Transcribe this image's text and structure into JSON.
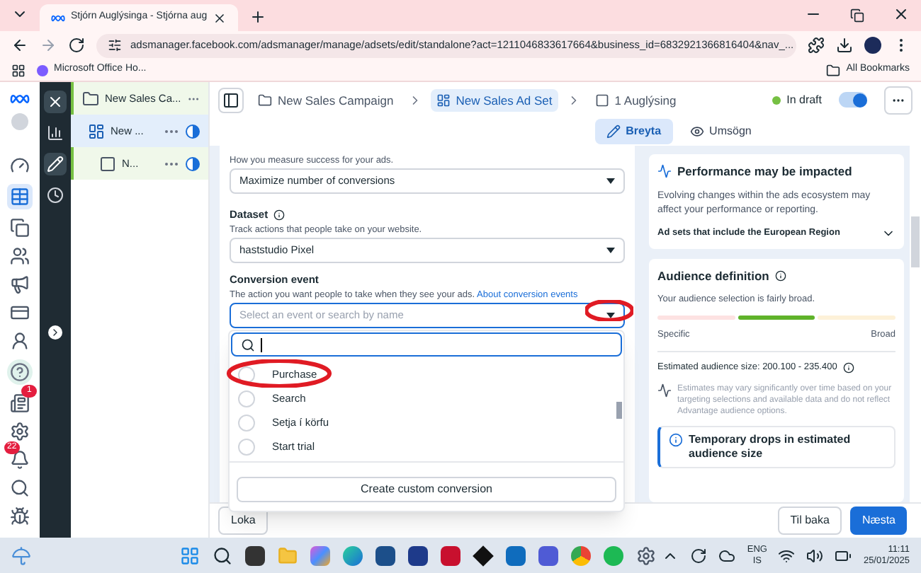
{
  "browser": {
    "tab_title": "Stjórn Auglýsinga - Stjórna aug",
    "url": "adsmanager.facebook.com/adsmanager/manage/adsets/edit/standalone?act=1211046833617664&business_id=683292136681640​4&nav_...",
    "bookmarks": [
      "Microsoft Office Ho..."
    ],
    "all_bookmarks": "All Bookmarks"
  },
  "rail_badges": {
    "notices": "1",
    "alerts": "22"
  },
  "tree": [
    {
      "label": "New Sales Ca...",
      "kind": "campaign",
      "selected": false
    },
    {
      "label": "New ...",
      "kind": "adset",
      "selected": true
    },
    {
      "label": "N...",
      "kind": "ad",
      "selected": false
    }
  ],
  "breadcrumbs": [
    {
      "label": "New Sales Campaign",
      "kind": "campaign",
      "selected": false
    },
    {
      "label": "New Sales Ad Set",
      "kind": "adset",
      "selected": true
    },
    {
      "label": "1 Auglýsing",
      "kind": "ad",
      "selected": false
    }
  ],
  "status": {
    "label": "In draft",
    "on": true
  },
  "mode_tabs": [
    {
      "label": "Breyta",
      "kind": "edit",
      "selected": true
    },
    {
      "label": "Umsögn",
      "kind": "review",
      "selected": false
    }
  ],
  "form": {
    "goal_hint": "How you measure success for your ads.",
    "goal_value": "Maximize number of conversions",
    "dataset": {
      "label": "Dataset",
      "hint": "Track actions that people take on your website.",
      "value": "haststudio Pixel"
    },
    "conversion_event": {
      "label": "Conversion event",
      "hint": "The action you want people to take when they see your ads.",
      "link": "About conversion events",
      "placeholder": "Select an event or search by name"
    }
  },
  "dropdown": {
    "options": [
      {
        "label": "Purchase",
        "selected": false
      },
      {
        "label": "Search",
        "selected": false
      },
      {
        "label": "Setja í körfu",
        "selected": false
      },
      {
        "label": "Start trial",
        "selected": false
      }
    ],
    "create_button": "Create custom conversion"
  },
  "performance": {
    "title": "Performance may be impacted",
    "body": "Evolving changes within the ads ecosystem may affect your performance or reporting.",
    "accordion": "Ad sets that include the European Region",
    "expanded": false
  },
  "audience": {
    "title": "Audience definition",
    "subtitle": "Your audience selection is fairly broad.",
    "segments": [
      {
        "selected": false
      },
      {
        "selected": true
      },
      {
        "selected": false
      }
    ],
    "low_label": "Specific",
    "high_label": "Broad",
    "estimate": "Estimated audience size: 200.100 - 235.400",
    "note": "Estimates may vary significantly over time based on your targeting selections and available data and do not reflect Advantage audience options.",
    "alert": "Temporary drops in estimated audience size"
  },
  "footer": {
    "close": "Loka",
    "back": "Til baka",
    "next": "Næsta"
  },
  "taskbar": {
    "lang": "ENG",
    "region": "IS",
    "time": "11:11",
    "date": "25/01/2025"
  }
}
